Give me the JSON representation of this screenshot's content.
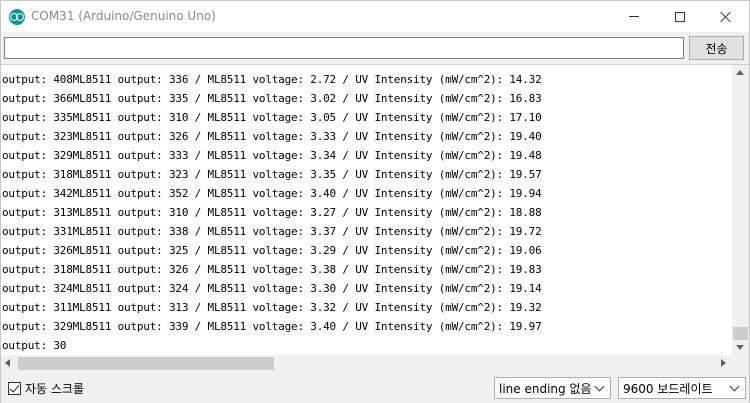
{
  "window": {
    "title": "COM31 (Arduino/Genuino Uno)"
  },
  "input": {
    "value": "",
    "send_label": "전송"
  },
  "output": {
    "lines": [
      "output: 408ML8511 output: 336 / ML8511 voltage: 2.72 / UV Intensity (mW/cm^2): 14.32",
      "output: 366ML8511 output: 335 / ML8511 voltage: 3.02 / UV Intensity (mW/cm^2): 16.83",
      "output: 335ML8511 output: 310 / ML8511 voltage: 3.05 / UV Intensity (mW/cm^2): 17.10",
      "output: 323ML8511 output: 326 / ML8511 voltage: 3.33 / UV Intensity (mW/cm^2): 19.40",
      "output: 329ML8511 output: 333 / ML8511 voltage: 3.34 / UV Intensity (mW/cm^2): 19.48",
      "output: 318ML8511 output: 323 / ML8511 voltage: 3.35 / UV Intensity (mW/cm^2): 19.57",
      "output: 342ML8511 output: 352 / ML8511 voltage: 3.40 / UV Intensity (mW/cm^2): 19.94",
      "output: 313ML8511 output: 310 / ML8511 voltage: 3.27 / UV Intensity (mW/cm^2): 18.88",
      "output: 331ML8511 output: 338 / ML8511 voltage: 3.37 / UV Intensity (mW/cm^2): 19.72",
      "output: 326ML8511 output: 325 / ML8511 voltage: 3.29 / UV Intensity (mW/cm^2): 19.06",
      "output: 318ML8511 output: 326 / ML8511 voltage: 3.38 / UV Intensity (mW/cm^2): 19.83",
      "output: 324ML8511 output: 324 / ML8511 voltage: 3.30 / UV Intensity (mW/cm^2): 19.14",
      "output: 311ML8511 output: 313 / ML8511 voltage: 3.32 / UV Intensity (mW/cm^2): 19.32",
      "output: 329ML8511 output: 339 / ML8511 voltage: 3.40 / UV Intensity (mW/cm^2): 19.97",
      "output: 30"
    ]
  },
  "bottom": {
    "autoscroll_label": "자동 스크롤",
    "autoscroll_checked": true,
    "line_ending": "line ending 없음",
    "baud": "9600 보드레이트"
  },
  "icons": {
    "app": "arduino-logo-icon",
    "minimize": "minimize-icon",
    "maximize": "maximize-icon",
    "close": "close-icon"
  }
}
